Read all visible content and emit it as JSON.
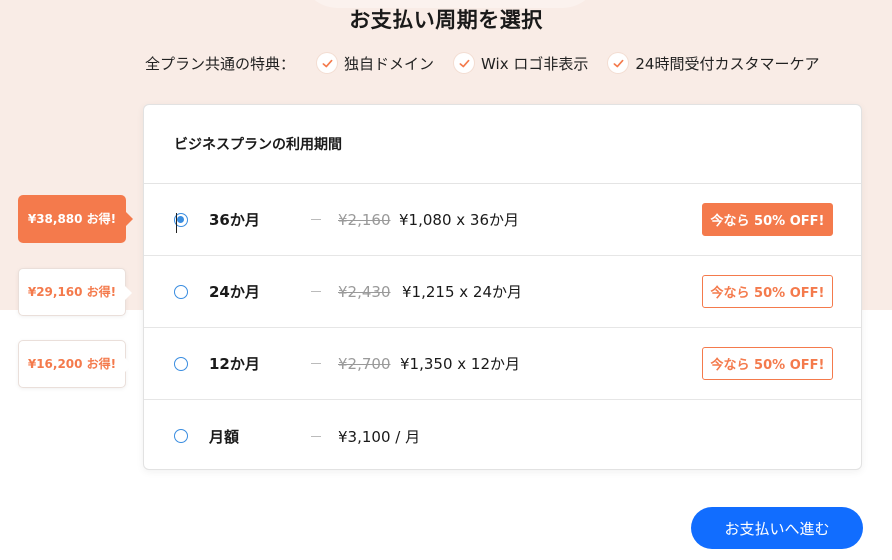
{
  "page": {
    "title": "お支払い周期を選択"
  },
  "benefits": {
    "label": "全プラン共通の特典：",
    "items": [
      {
        "label": "独自ドメイン"
      },
      {
        "label": "Wix ロゴ非表示"
      },
      {
        "label": "24時間受付カスタマーケア"
      }
    ]
  },
  "card": {
    "title": "ビジネスプランの利用期間",
    "options": [
      {
        "term": "36か月",
        "old_price": "¥2,160",
        "new_price": "¥1,080 x 36か月",
        "badge": "今なら 50% OFF!",
        "savings": "¥38,880 お得!",
        "selected": true
      },
      {
        "term": "24か月",
        "old_price": "¥2,430",
        "new_price": "¥1,215 x 24か月",
        "badge": "今なら 50% OFF!",
        "savings": "¥29,160 お得!",
        "selected": false
      },
      {
        "term": "12か月",
        "old_price": "¥2,700",
        "new_price": "¥1,350 x 12か月",
        "badge": "今なら 50% OFF!",
        "savings": "¥16,200 お得!",
        "selected": false
      },
      {
        "term": "月額",
        "price": "¥3,100 / 月",
        "selected": false
      }
    ]
  },
  "actions": {
    "proceed_label": "お支払いへ進む"
  },
  "colors": {
    "accent": "#f47a4c",
    "primary": "#116dff",
    "radio": "#3a8de0",
    "background": "#f9ece6"
  }
}
